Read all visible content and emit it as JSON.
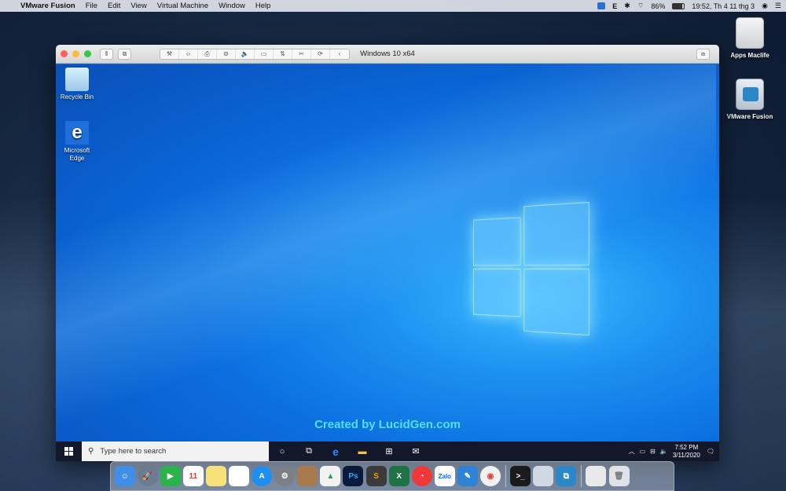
{
  "menubar": {
    "app_name": "VMware Fusion",
    "menus": [
      "File",
      "Edit",
      "View",
      "Virtual Machine",
      "Window",
      "Help"
    ],
    "battery": "86%",
    "datetime": "19:52, Th 4 11 thg 3",
    "input_indicator": "E"
  },
  "desktop_icons": [
    {
      "label": "Apps Maclife"
    },
    {
      "label": "VMware Fusion"
    }
  ],
  "vm_window": {
    "title": "Windows 10 x64",
    "toolbar_glyphs": [
      "⚒",
      "‹›",
      "⎙",
      "⊜",
      "🔈",
      "▭",
      "⇅",
      "✂",
      "⟳",
      "‹"
    ]
  },
  "guest": {
    "icons": [
      {
        "label": "Recycle Bin"
      },
      {
        "label": "Microsoft Edge"
      }
    ],
    "watermark": "Created by LucidGen.com",
    "taskbar": {
      "search_placeholder": "Type here to search",
      "time": "7:52 PM",
      "date": "3/11/2020"
    }
  },
  "colors": {
    "win_blue": "#0c6fe0",
    "taskbar": "#12182a",
    "watermark": "#56e0ff"
  },
  "dock_icons": [
    "finder-icon",
    "launchpad-icon",
    "facetime-icon",
    "calendar-icon",
    "notes-icon",
    "reminders-icon",
    "app-store-icon",
    "system-preferences-icon",
    "books-icon",
    "google-drive-icon",
    "photoshop-icon",
    "sublime-icon",
    "excel-icon",
    "vivaldi-icon",
    "zalo-icon",
    "pen-icon",
    "chrome-icon",
    "terminal-icon",
    "preview-icon",
    "vmware-fusion-icon",
    "browser-window-icon",
    "trash-icon"
  ]
}
